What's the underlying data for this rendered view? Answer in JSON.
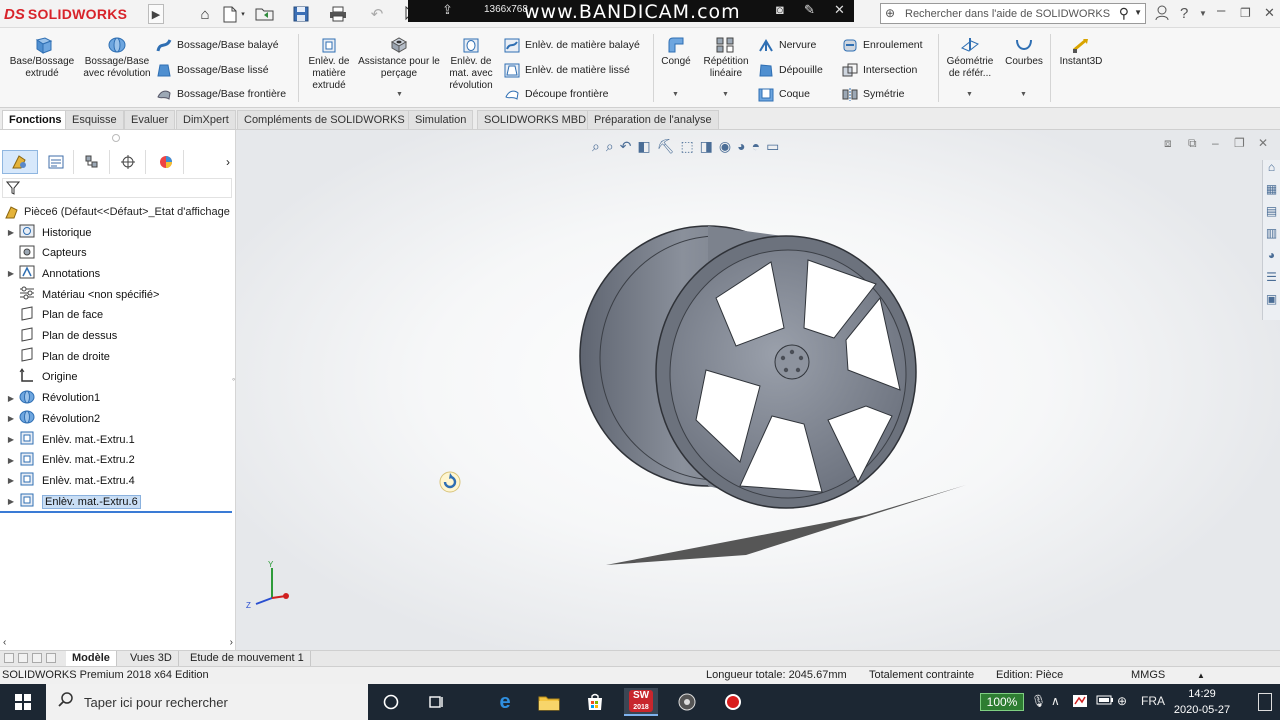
{
  "titlebar": {
    "logo_mark": "DS",
    "logo_text": "SOLIDWORKS",
    "arrow": "▶",
    "recorder_resolution": "1366x768",
    "recorder_brand": "www.BANDICAM.com",
    "search_placeholder": "Rechercher dans l'aide de SOLIDWORKS",
    "help": "?"
  },
  "ribbon": {
    "base_extrude": "Base/Bossage extrudé",
    "base_revolve": "Bossage/Base avec révolution",
    "swept": "Bossage/Base balayé",
    "loft": "Bossage/Base lissé",
    "boundary": "Bossage/Base frontière",
    "cut_extrude": "Enlèv. de matière extrudé",
    "hole_wizard": "Assistance pour le perçage",
    "cut_revolve": "Enlèv. de mat. avec révolution",
    "cut_swept": "Enlèv. de matière balayé",
    "cut_loft": "Enlèv. de matière lissé",
    "cut_boundary": "Découpe frontière",
    "fillet": "Congé",
    "pattern": "Répétition linéaire",
    "rib": "Nervure",
    "draft": "Dépouille",
    "shell": "Coque",
    "wrap": "Enroulement",
    "intersect": "Intersection",
    "mirror": "Symétrie",
    "ref_geometry": "Géométrie de référ...",
    "curves": "Courbes",
    "instant3d": "Instant3D"
  },
  "tabs": [
    "Fonctions",
    "Esquisse",
    "Evaluer",
    "DimXpert",
    "Compléments de SOLIDWORKS",
    "Simulation",
    "SOLIDWORKS MBD",
    "Préparation de l'analyse"
  ],
  "tree": {
    "root": "Pièce6  (Défaut<<Défaut>_Etat d'affichage",
    "items": [
      {
        "label": "Historique",
        "expand": true
      },
      {
        "label": "Capteurs",
        "expand": false
      },
      {
        "label": "Annotations",
        "expand": true
      },
      {
        "label": "Matériau <non spécifié>",
        "expand": false
      },
      {
        "label": "Plan de face",
        "expand": false
      },
      {
        "label": "Plan de dessus",
        "expand": false
      },
      {
        "label": "Plan de droite",
        "expand": false
      },
      {
        "label": "Origine",
        "expand": false
      },
      {
        "label": "Révolution1",
        "expand": true
      },
      {
        "label": "Révolution2",
        "expand": true
      },
      {
        "label": "Enlèv. mat.-Extru.1",
        "expand": true
      },
      {
        "label": "Enlèv. mat.-Extru.2",
        "expand": true
      },
      {
        "label": "Enlèv. mat.-Extru.4",
        "expand": true
      },
      {
        "label": "Enlèv. mat.-Extru.6",
        "expand": true,
        "selected": true
      }
    ]
  },
  "viewport": {
    "axis_y": "Y",
    "axis_z": "Z"
  },
  "bottom_tabs": [
    "Modèle",
    "Vues 3D",
    "Etude de mouvement 1"
  ],
  "status": {
    "app": "SOLIDWORKS Premium 2018 x64 Edition",
    "length": "Longueur totale: 2045.67mm",
    "constraint": "Totalement contrainte",
    "edition": "Edition: Pièce",
    "units": "MMGS",
    "units_arrow": "▲"
  },
  "taskbar": {
    "search_placeholder": "Taper ici pour rechercher",
    "sw_badge": "2018",
    "battery": "100%",
    "lang": "FRA",
    "time": "14:29",
    "date": "2020-05-27"
  },
  "colors": {
    "accent": "#3a7bd5",
    "logo_red": "#d8232a",
    "wheel": "#7f8592",
    "taskbar": "#1c2733"
  }
}
